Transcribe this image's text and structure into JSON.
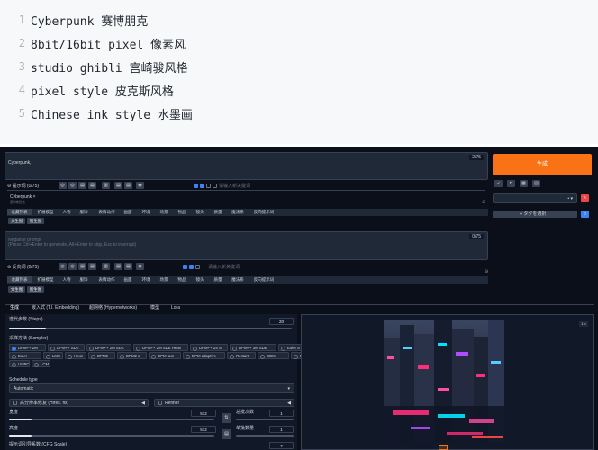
{
  "code_lines": [
    {
      "num": "1",
      "text": "Cyberpunk 赛博朋克"
    },
    {
      "num": "2",
      "text": "8bit/16bit pixel 像素风"
    },
    {
      "num": "3",
      "text": "studio ghibli 宫崎骏风格"
    },
    {
      "num": "4",
      "text": "pixel style 皮克斯风格"
    },
    {
      "num": "5",
      "text": "Chinese ink style 水墨画"
    }
  ],
  "webui": {
    "prompt": {
      "value": "Cyberpunk,",
      "counter": "2/75",
      "label": "⊖ 提示词 (0/75)",
      "tag": "Cyberpunk ×",
      "tag_hint": "赛 博朋克",
      "input_placeholder": "请输入新关键词",
      "categories": [
        "收藏列表",
        "扩展模型",
        "人物",
        "服饰",
        "表情动作",
        "画面",
        "环境",
        "场景",
        "物品",
        "镜头",
        "质量",
        "魔法系",
        "反向提示词"
      ],
      "sub": [
        "文生图",
        "图生图"
      ]
    },
    "negative": {
      "placeholder": "Negative prompt\n(Press Ctrl+Enter to generate, Alt+Enter to skip, Esc to interrupt)",
      "counter": "0/75",
      "label": "⊖ 反向词 (0/75)",
      "input_placeholder": "请输入新关键词",
      "categories": [
        "收藏列表",
        "扩展模型",
        "人物",
        "服饰",
        "表情动作",
        "画面",
        "环境",
        "场景",
        "物品",
        "镜头",
        "质量",
        "魔法系",
        "反向提示词"
      ],
      "sub": [
        "文生图",
        "图生图"
      ]
    },
    "right_panel": {
      "generate_label": "生成",
      "tool_icons": [
        "↙",
        "◘",
        "▦",
        "▤"
      ],
      "style_select_value": "",
      "style_apply_label": "● タグを選択"
    },
    "tabs": [
      "生成",
      "嵌入式 (T.I. Embedding)",
      "超网络 (Hypernetworks)",
      "模型",
      "Lora"
    ],
    "settings": {
      "steps_label": "迭代步数 (Steps)",
      "steps_value": "20",
      "steps_fraction": 0.13,
      "sampler_label": "采样方法 (Sampler)",
      "samplers": [
        "DPM++ 2M",
        "DPM++ SDE",
        "DPM++ 2M SDE",
        "DPM++ 2M SDE Heun",
        "DPM++ 2S a",
        "DPM++ 3M SDE",
        "Euler a",
        "Euler",
        "LMS",
        "Heun",
        "DPM2",
        "DPM2 a",
        "DPM fast",
        "DPM adaptive",
        "Restart",
        "DDIM",
        "PLMS",
        "UniPC",
        "LCM"
      ],
      "sampler_selected": "DPM++ 2M",
      "schedule_label": "Schedule type",
      "schedule_value": "Automatic",
      "hires_label": "高分辨率修复 (Hires. fix)",
      "refiner_label": "Refiner",
      "width_label": "宽度",
      "width_value": "512",
      "height_label": "高度",
      "height_value": "512",
      "batch_count_label": "总批次数",
      "batch_count_value": "1",
      "batch_size_label": "单批数量",
      "batch_size_value": "1",
      "cfg_label": "提示词引导系数 (CFG Scale)",
      "cfg_value": "7",
      "swap_label": "⇅"
    },
    "output": {
      "counter": "1 ×"
    }
  }
}
